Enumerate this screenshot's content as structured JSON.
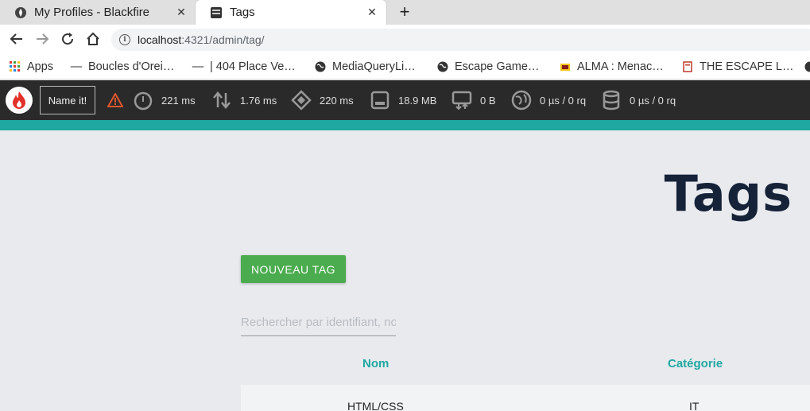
{
  "browser": {
    "tabs": [
      {
        "title": "My Profiles - Blackfire",
        "active": false
      },
      {
        "title": "Tags",
        "active": true
      }
    ],
    "new_tab": "+",
    "close": "✕",
    "url": {
      "host": "localhost",
      "path": ":4321/admin/tag/"
    }
  },
  "bookmarks": [
    {
      "label": "Apps",
      "icon": "apps-grid-icon"
    },
    {
      "label": "Boucles d'Orei…",
      "icon": "dash-icon"
    },
    {
      "label": "| 404 Place Ve…",
      "icon": "dash-icon"
    },
    {
      "label": "MediaQueryLi…",
      "icon": "globe-icon"
    },
    {
      "label": "Escape Game…",
      "icon": "globe-icon"
    },
    {
      "label": "ALMA : Menac…",
      "icon": "site-icon"
    },
    {
      "label": "THE ESCAPE L…",
      "icon": "bookmark-doc-icon"
    }
  ],
  "blackfire": {
    "name_button": "Name it!",
    "metrics": [
      {
        "value": "221 ms",
        "icon": "stopwatch-icon"
      },
      {
        "value": "1.76 ms",
        "icon": "io-arrows-icon"
      },
      {
        "value": "220 ms",
        "icon": "cpu-icon"
      },
      {
        "value": "18.9 MB",
        "icon": "memory-icon"
      },
      {
        "value": "0 B",
        "icon": "network-icon"
      },
      {
        "value": "0 µs / 0 rq",
        "icon": "http-globe-icon"
      },
      {
        "value": "0 µs / 0 rq",
        "icon": "database-icon"
      }
    ],
    "colors": {
      "bar": "#2a2a2a",
      "accent": "#1fa8a1",
      "warning": "#e2572b",
      "flame": "#e2312a"
    }
  },
  "page": {
    "title": "Tags",
    "new_button": "NOUVEAU TAG",
    "search_placeholder": "Rechercher par identifiant, nom",
    "columns": [
      "Nom",
      "Catégorie"
    ],
    "rows": [
      {
        "nom": "HTML/CSS",
        "categorie": "IT"
      }
    ],
    "colors": {
      "primary_button": "#4aac4e",
      "header_text": "#1fa8a1",
      "title": "#152238"
    }
  }
}
